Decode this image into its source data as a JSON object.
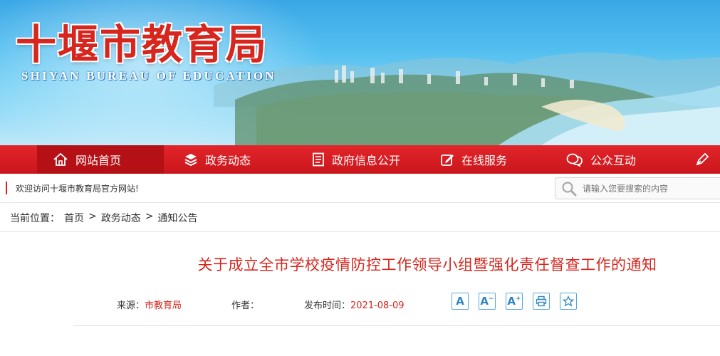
{
  "banner": {
    "title": "十堰市教育局",
    "subtitle": "SHIYAN BUREAU OF EDUCATION"
  },
  "nav": {
    "items": [
      {
        "label": "网站首页",
        "icon": "home-icon"
      },
      {
        "label": "政务动态",
        "icon": "layers-icon"
      },
      {
        "label": "政府信息公开",
        "icon": "document-icon"
      },
      {
        "label": "在线服务",
        "icon": "edit-icon"
      },
      {
        "label": "公众互动",
        "icon": "chat-icon"
      },
      {
        "label": "",
        "icon": "pen-icon"
      }
    ]
  },
  "welcome": {
    "text": "欢迎访问十堰市教育局官方网站!"
  },
  "search": {
    "placeholder": "请输入您要搜索的内容"
  },
  "breadcrumb": {
    "label": "当前位置：",
    "items": [
      "首页",
      "政务动态",
      "通知公告"
    ],
    "separator": ">"
  },
  "article": {
    "title": "关于成立全市学校疫情防控工作领导小组暨强化责任督查工作的通知",
    "source_label": "来源：",
    "source_value": "市教育局",
    "author_label": "作者：",
    "author_value": "",
    "date_label": "发布时间：",
    "date_value": "2021-08-09"
  },
  "tools": [
    {
      "label": "A",
      "icon": "font-normal-icon"
    },
    {
      "label": "A-",
      "icon": "font-decrease-icon"
    },
    {
      "label": "A+",
      "icon": "font-increase-icon"
    },
    {
      "label": "",
      "icon": "print-icon"
    },
    {
      "label": "",
      "icon": "favorite-star-icon"
    }
  ],
  "colors": {
    "brand_red": "#d6261e",
    "nav_red": "#e2252a",
    "sky_blue": "#53bff0",
    "tool_blue": "#2f86c4"
  }
}
